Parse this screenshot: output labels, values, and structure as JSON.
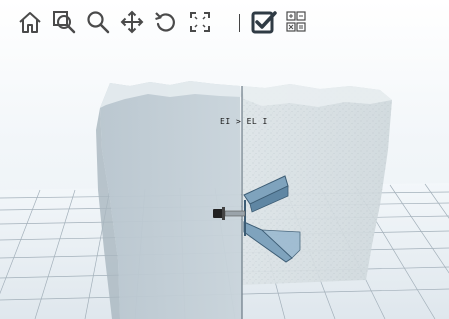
{
  "toolbar": {
    "tools": [
      {
        "id": "home",
        "icon": "home-icon"
      },
      {
        "id": "zoom-window",
        "icon": "zoom-window-icon"
      },
      {
        "id": "zoom",
        "icon": "magnifier-icon"
      },
      {
        "id": "pan",
        "icon": "move-arrows-icon"
      },
      {
        "id": "rotate",
        "icon": "rotate-icon"
      },
      {
        "id": "fullscreen",
        "icon": "fullscreen-icon"
      },
      {
        "id": "select",
        "icon": "checkbox-checked-icon"
      },
      {
        "id": "section",
        "icon": "section-grid-icon"
      }
    ]
  },
  "viewport": {
    "model_label": "EI > EL I"
  },
  "colors": {
    "toolbar_icon": "#4a4a4a",
    "select_icon": "#2f3b44",
    "wall_face": "#b9c6cf",
    "wall_side": "#d0d9dd",
    "bracket": "#6f95b0",
    "grid_line": "#9aa8b2"
  }
}
